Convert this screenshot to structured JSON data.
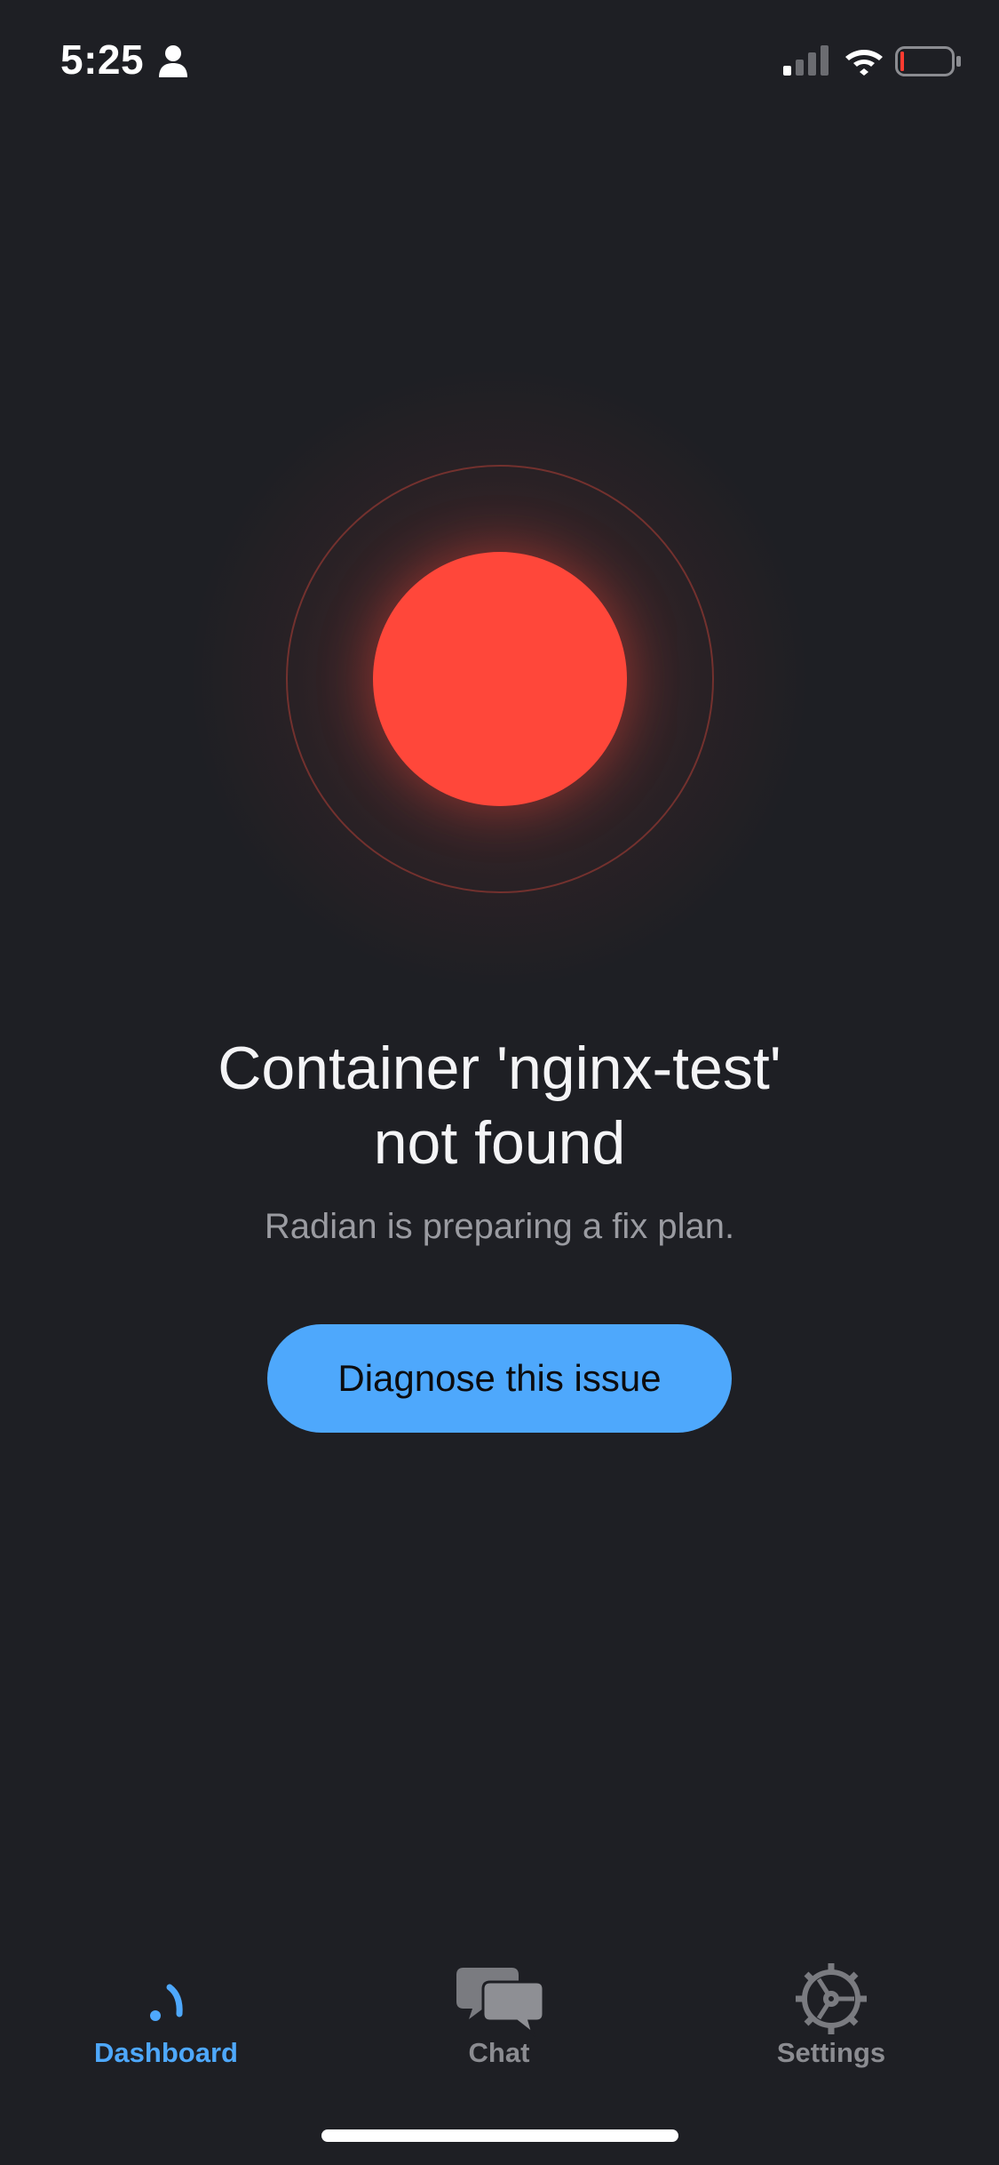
{
  "status_bar": {
    "time": "5:25",
    "person_icon": "person-icon",
    "signal_icon": "cellular-signal-icon",
    "wifi_icon": "wifi-icon",
    "battery_icon": "battery-low-icon",
    "battery_color": "#ff3b30"
  },
  "status_indicator": {
    "state": "error",
    "color": "#ff473a"
  },
  "message": {
    "title_line1": "Container 'nginx-test'",
    "title_line2": "not found",
    "subtitle": "Radian is preparing a fix plan."
  },
  "cta": {
    "label": "Diagnose this issue",
    "color": "#4ea8fc"
  },
  "tabbar": {
    "active": "Dashboard",
    "accent": "#4ea8fc",
    "items": [
      {
        "label": "Dashboard",
        "icon": "dashboard-gauge-icon"
      },
      {
        "label": "Chat",
        "icon": "chat-bubbles-icon"
      },
      {
        "label": "Settings",
        "icon": "gear-icon"
      }
    ]
  }
}
